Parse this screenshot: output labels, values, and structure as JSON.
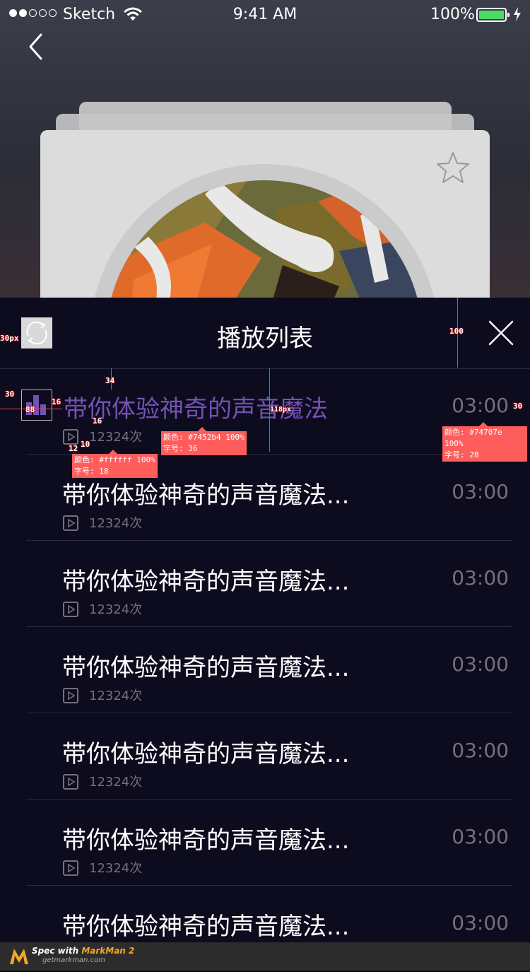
{
  "status_bar": {
    "carrier": "Sketch",
    "time": "9:41 AM",
    "battery": "100%",
    "battery_color": "#4cd964"
  },
  "playlist": {
    "title": "播放列表",
    "items": [
      {
        "title": "带你体验神奇的声音魔法",
        "duration": "03:00",
        "plays": "12324次",
        "active": true
      },
      {
        "title": "带你体验神奇的声音魔法...",
        "duration": "03:00",
        "plays": "12324次",
        "active": false
      },
      {
        "title": "带你体验神奇的声音魔法...",
        "duration": "03:00",
        "plays": "12324次",
        "active": false
      },
      {
        "title": "带你体验神奇的声音魔法...",
        "duration": "03:00",
        "plays": "12324次",
        "active": false
      },
      {
        "title": "带你体验神奇的声音魔法...",
        "duration": "03:00",
        "plays": "12324次",
        "active": false
      },
      {
        "title": "带你体验神奇的声音魔法...",
        "duration": "03:00",
        "plays": "12324次",
        "active": false
      },
      {
        "title": "带你体验神奇的声音魔法...",
        "duration": "03:00",
        "plays": "",
        "active": false
      }
    ]
  },
  "colors": {
    "active_title": "#7452b4",
    "duration": "#74707e",
    "title": "#ffffff",
    "sheet_bg": "#0d0b1e"
  },
  "icons": {
    "back": "chevron-left-icon",
    "favorite": "star-icon",
    "loop": "loop-icon",
    "close": "close-icon",
    "playing": "equalizer-icon",
    "plays": "play-square-icon"
  },
  "annotations": {
    "marks": [
      "30px",
      "30",
      "88",
      "16",
      "34",
      "16",
      "10",
      "12",
      "100",
      "118px",
      "30"
    ],
    "title_tip": {
      "color": "颜色: #7452b4 100%",
      "size": "字号: 36"
    },
    "count_tip": {
      "color": "颜色: #ffffff 100%",
      "size": "字号: 18"
    },
    "duration_tip": {
      "color": "颜色: #74707e 100%",
      "size": "字号: 28"
    }
  },
  "footer": {
    "line1_prefix": "Spec with ",
    "line1_brand": "MarkMan 2",
    "line2": "getmarkman.com"
  }
}
